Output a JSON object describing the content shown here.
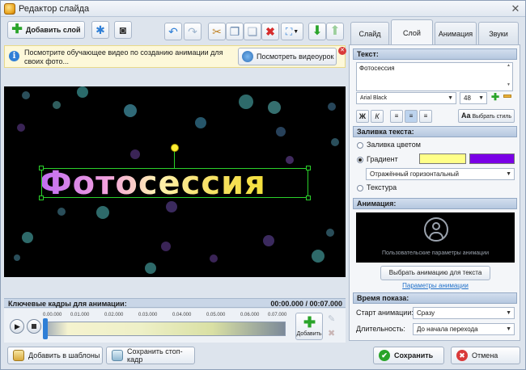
{
  "window": {
    "title": "Редактор слайда",
    "close": "✕"
  },
  "toolbar": {
    "add_layer": "Добавить слой"
  },
  "info": {
    "text": "Посмотрите обучающее видео по созданию анимации для своих фото...",
    "watch_label": "Посмотреть видеоурок",
    "close": "✕"
  },
  "stage": {
    "title_text": "Фотосессия"
  },
  "timeline": {
    "label": "Ключевые кадры для анимации:",
    "time": "00:00.000 / 00:07.000",
    "ticks": [
      "0.00.000",
      "0.01.000",
      "0.02.000",
      "0.03.000",
      "0.04.000",
      "0.05.000",
      "0.06.000",
      "0.07.000"
    ],
    "add_label": "Добавить"
  },
  "bottom": {
    "add_template": "Добавить в шаблоны",
    "save_frame": "Сохранить стоп-кадр",
    "save": "Сохранить",
    "cancel": "Отмена"
  },
  "tabs": [
    "Слайд",
    "Слой",
    "Анимация",
    "Звуки"
  ],
  "active_tab": "Слой",
  "panel": {
    "text_section": "Текст:",
    "text_value": "Фотосессия",
    "font": "Arial Black",
    "size": "48",
    "bold": "Ж",
    "italic": "К",
    "choose_style": "Выбрать стиль",
    "fill_section": "Заливка текста:",
    "fill_color": "Заливка цветом",
    "gradient": "Градиент",
    "gradient_color1": "#ffff88",
    "gradient_color2": "#7a00e6",
    "gradient_type": "Отражённый горизонтальный",
    "texture": "Текстура",
    "anim_section": "Анимация:",
    "anim_caption": "Пользовательские параметры анимации",
    "choose_anim": "Выбрать анимацию для текста",
    "anim_params": "Параметры анимации",
    "time_section": "Время показа:",
    "start_label": "Старт анимации:",
    "start_value": "Сразу",
    "duration_label": "Длительность:",
    "duration_value": "До начала перехода"
  },
  "colors": {
    "accent": "#2f7fd6",
    "selection": "#2bd12b",
    "stage_bg": "#000000"
  }
}
